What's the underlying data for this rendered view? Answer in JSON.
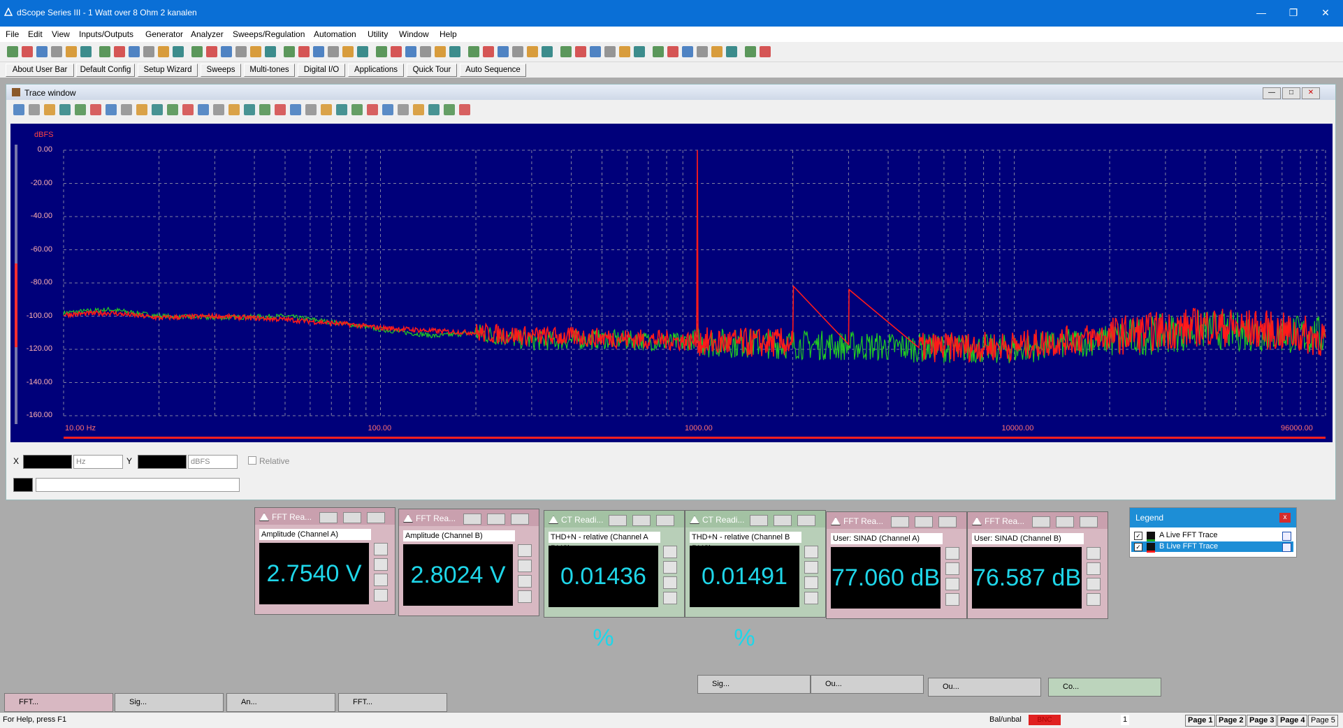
{
  "window": {
    "title": "dScope Series III - 1 Watt over 8 Ohm 2 kanalen"
  },
  "menu": [
    "File",
    "Edit",
    "View",
    "Inputs/Outputs",
    "Generator",
    "Analyzer",
    "Sweeps/Regulation",
    "Automation",
    "Utility",
    "Window",
    "Help"
  ],
  "user_bar": [
    "About User Bar",
    "Default Config",
    "Setup Wizard",
    "Sweeps",
    "Multi-tones",
    "Digital I/O",
    "Applications",
    "Quick Tour",
    "Auto Sequence"
  ],
  "trace_window": {
    "title": "Trace window",
    "y_unit_label": "dBFS",
    "y_ticks": [
      "0.00",
      "-20.00",
      "-40.00",
      "-60.00",
      "-80.00",
      "-100.00",
      "-120.00",
      "-140.00",
      "-160.00"
    ],
    "x_ticks": [
      "10.00 Hz",
      "100.00",
      "1000.00",
      "10000.00",
      "96000.00"
    ],
    "cursor": {
      "x_label": "X",
      "x_unit": "Hz",
      "y_label": "Y",
      "y_unit": "dBFS",
      "relative_label": "Relative"
    }
  },
  "chart_data": {
    "type": "line",
    "xscale": "log",
    "xlim": [
      10,
      96000
    ],
    "ylim": [
      -170,
      5
    ],
    "ylabel": "dBFS",
    "series": [
      {
        "name": "A Live FFT Trace",
        "color": "#22cc22",
        "x": [
          10,
          14,
          20,
          30,
          50,
          80,
          100,
          150,
          200,
          300,
          500,
          700,
          900,
          1000,
          1010,
          1100,
          2000,
          3000,
          5000,
          10000,
          20000,
          40000,
          60000,
          96000
        ],
        "y": [
          -98,
          -96,
          -100,
          -101,
          -100,
          -105,
          -108,
          -112,
          -110,
          -115,
          -114,
          -115,
          -116,
          -113,
          -116,
          -116,
          -117,
          -118,
          -119,
          -120,
          -114,
          -108,
          -110,
          -112
        ]
      },
      {
        "name": "B Live FFT Trace",
        "color": "#ff1a1a",
        "x": [
          10,
          14,
          20,
          30,
          50,
          80,
          100,
          150,
          200,
          300,
          500,
          700,
          900,
          995,
          1000,
          1005,
          1100,
          2000,
          2010,
          3000,
          3010,
          5000,
          10000,
          20000,
          40000,
          60000,
          96000
        ],
        "y": [
          -99,
          -98,
          -101,
          -100,
          -102,
          -105,
          -107,
          -109,
          -110,
          -112,
          -113,
          -114,
          -115,
          -115,
          0,
          -115,
          -116,
          -116,
          -82,
          -117,
          -84,
          -119,
          -118,
          -112,
          -106,
          -108,
          -113
        ]
      }
    ]
  },
  "readouts": [
    {
      "title": "FFT Rea...",
      "label": "Amplitude (Channel A)",
      "value": "2.7540 V",
      "kind": "fft"
    },
    {
      "title": "FFT Rea...",
      "label": "Amplitude (Channel B)",
      "value": "2.8024 V",
      "kind": "fft"
    },
    {
      "title": "CT Readi...",
      "label": "THD+N - relative (Channel A RMS)",
      "value": "0.01436 %",
      "kind": "ct"
    },
    {
      "title": "CT Readi...",
      "label": "THD+N - relative (Channel B RMS)",
      "value": "0.01491 %",
      "kind": "ct"
    },
    {
      "title": "FFT Rea...",
      "label": "User: SINAD (Channel A)",
      "value": "77.060 dB",
      "kind": "fft"
    },
    {
      "title": "FFT Rea...",
      "label": "User: SINAD (Channel B)",
      "value": "76.587 dB",
      "kind": "fft"
    }
  ],
  "legend": {
    "title": "Legend",
    "items": [
      {
        "label": "A  Live FFT Trace",
        "color": "#22aa22",
        "selected": false
      },
      {
        "label": "B  Live FFT Trace",
        "color": "#ff1a1a",
        "selected": true
      }
    ]
  },
  "minimized_right": [
    {
      "label": "Sig..."
    },
    {
      "label": "Ou..."
    },
    {
      "label": "Ou..."
    },
    {
      "label": "Co..."
    }
  ],
  "minimized_bottom": [
    {
      "label": "FFT..."
    },
    {
      "label": "Sig..."
    },
    {
      "label": "An..."
    },
    {
      "label": "FFT..."
    }
  ],
  "status": {
    "help": "For Help, press F1",
    "balunbal": "Bal/unbal",
    "bnc": "BNC",
    "num": "1",
    "pages": [
      "Page 1",
      "Page 2",
      "Page 3",
      "Page 4",
      "Page 5"
    ]
  }
}
